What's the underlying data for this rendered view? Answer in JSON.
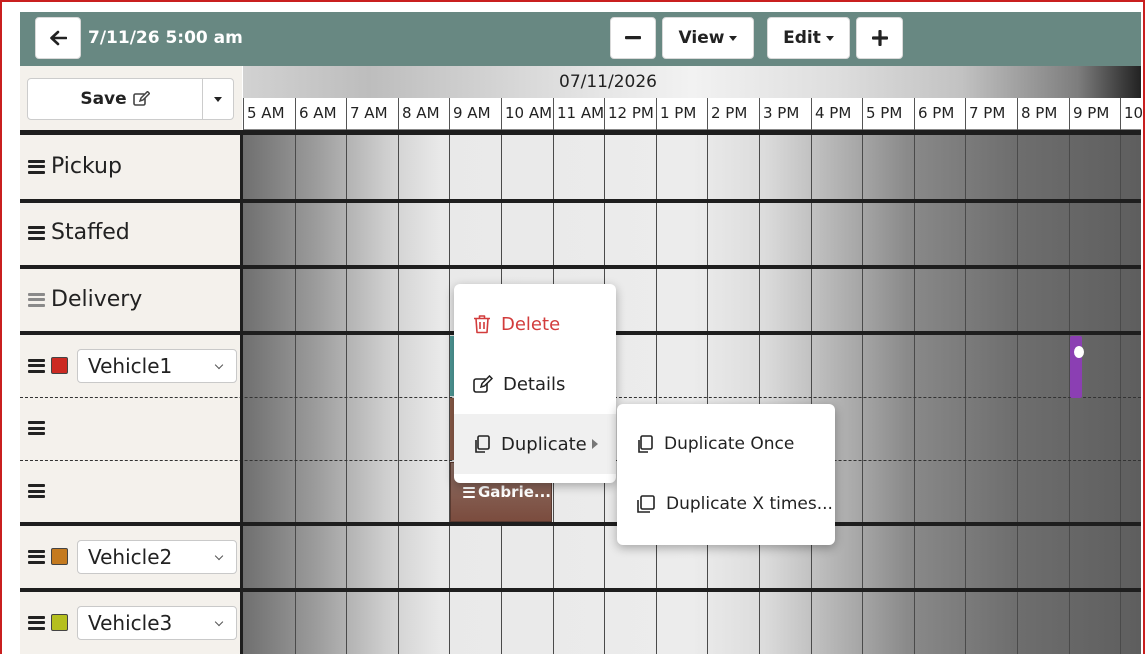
{
  "header": {
    "date_time": "7/11/26 5:00 am",
    "view_label": "View",
    "edit_label": "Edit"
  },
  "toolbar": {
    "save_label": "Save"
  },
  "timeline": {
    "date": "07/11/2026",
    "hours": [
      "5 AM",
      "6 AM",
      "7 AM",
      "8 AM",
      "9 AM",
      "10 AM",
      "11 AM",
      "12 PM",
      "1 PM",
      "2 PM",
      "3 PM",
      "4 PM",
      "5 PM",
      "6 PM",
      "7 PM",
      "8 PM",
      "9 PM",
      "10"
    ]
  },
  "rows": {
    "pickup": "Pickup",
    "staffed": "Staffed",
    "delivery": "Delivery",
    "vehicle1": {
      "name": "Vehicle1",
      "color": "#cc2a22"
    },
    "vehicle2": {
      "name": "Vehicle2",
      "color": "#c47a1f"
    },
    "vehicle3": {
      "name": "Vehicle3",
      "color": "#b5bf1e"
    }
  },
  "event": {
    "label": "Gabrie..."
  },
  "context_menu": {
    "delete": "Delete",
    "details": "Details",
    "duplicate": "Duplicate"
  },
  "submenu": {
    "duplicate_once": "Duplicate Once",
    "duplicate_x_times": "Duplicate X times..."
  },
  "colors": {
    "header_bg": "#688882",
    "delete_red": "#d23c3c",
    "frame_red": "#c91f1f"
  }
}
